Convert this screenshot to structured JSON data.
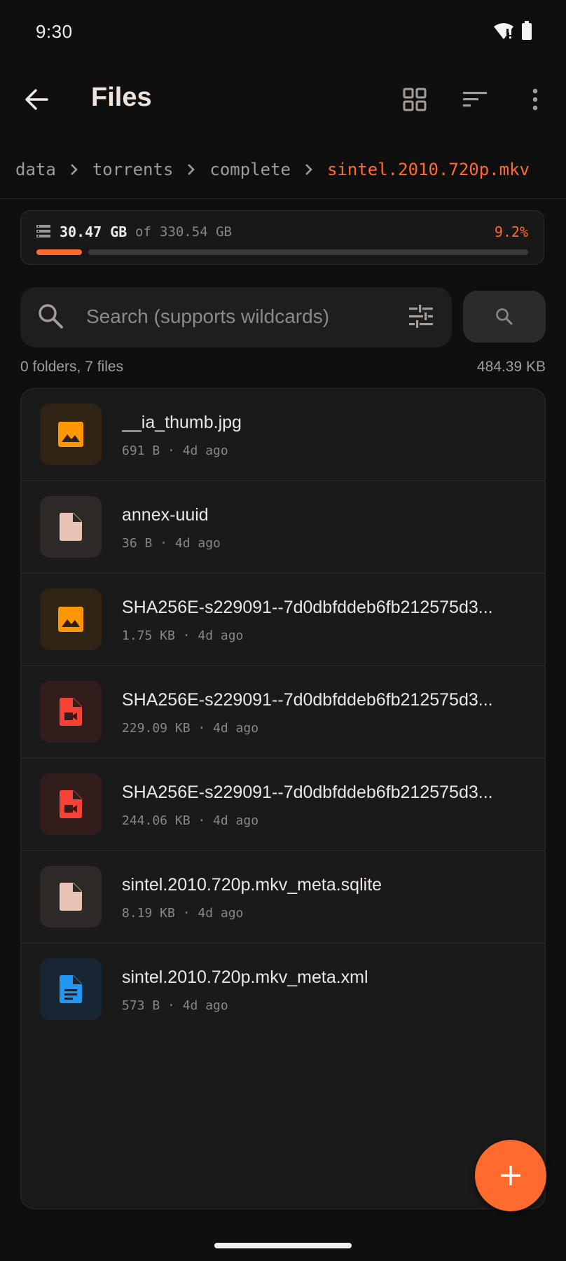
{
  "status_bar": {
    "time": "9:30",
    "icons": [
      "wifi-alert-icon",
      "battery-icon"
    ]
  },
  "app_bar": {
    "title": "Files",
    "actions": [
      "back-arrow-icon",
      "grid-view-icon",
      "sort-icon",
      "more-vert-icon"
    ]
  },
  "breadcrumb": {
    "items": [
      "data",
      "torrents",
      "complete",
      "sintel.2010.720p.mkv"
    ],
    "separator_icon": "chevron-right-icon",
    "active_color": "#ff6a2f"
  },
  "storage": {
    "used": "30.47 GB",
    "of_label": "of",
    "total": "330.54 GB",
    "percent": "9.2%",
    "fill_fraction": 0.092,
    "accent": "#ff6a2f"
  },
  "search": {
    "placeholder": "Search (supports wildcards)",
    "value": ""
  },
  "summary": {
    "counts": "0 folders, 7 files",
    "total_size": "484.39 KB"
  },
  "files": [
    {
      "name": "__ia_thumb.jpg",
      "meta": "691 B · 4d ago",
      "icon": "image-icon",
      "icon_color": "#ff9800"
    },
    {
      "name": "annex-uuid",
      "meta": "36 B · 4d ago",
      "icon": "file-icon",
      "icon_color": "#e8c2b3"
    },
    {
      "name": "SHA256E-s229091--7d0dbfddeb6fb212575d3...",
      "meta": "1.75 KB · 4d ago",
      "icon": "image-icon",
      "icon_color": "#ff9800"
    },
    {
      "name": "SHA256E-s229091--7d0dbfddeb6fb212575d3...",
      "meta": "229.09 KB · 4d ago",
      "icon": "video-file-icon",
      "icon_color": "#f44336"
    },
    {
      "name": "SHA256E-s229091--7d0dbfddeb6fb212575d3...",
      "meta": "244.06 KB · 4d ago",
      "icon": "video-file-icon",
      "icon_color": "#f44336"
    },
    {
      "name": "sintel.2010.720p.mkv_meta.sqlite",
      "meta": "8.19 KB · 4d ago",
      "icon": "file-icon",
      "icon_color": "#e8c2b3"
    },
    {
      "name": "sintel.2010.720p.mkv_meta.xml",
      "meta": "573 B · 4d ago",
      "icon": "document-icon",
      "icon_color": "#2196f3"
    }
  ],
  "fab": {
    "icon": "add-icon",
    "color": "#ff6a2f"
  }
}
